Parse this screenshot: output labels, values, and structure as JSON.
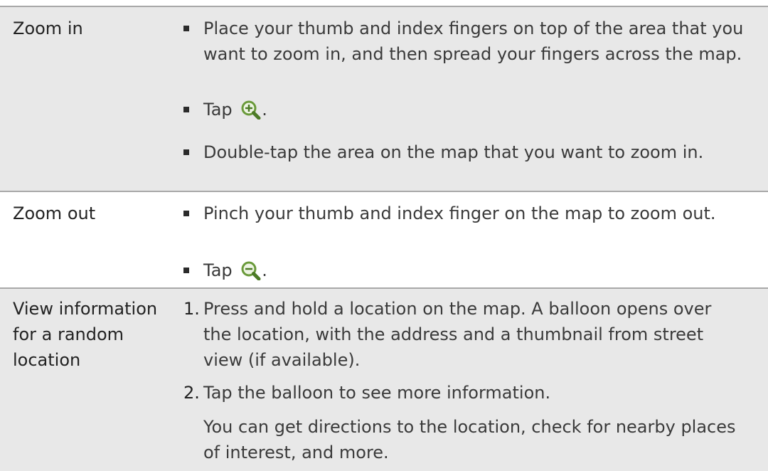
{
  "rows": [
    {
      "label": "Zoom in",
      "items": [
        {
          "text": "Place your thumb and index fingers on top of the area that you want to zoom in, and then spread your fingers across the map."
        },
        {
          "text": "Tap",
          "icon": "zoom-in-icon",
          "suffix": "."
        },
        {
          "text": "Double-tap the area on the map that you want to zoom in."
        }
      ]
    },
    {
      "label": "Zoom out",
      "items": [
        {
          "text": "Pinch your thumb and index finger on the map to zoom out."
        },
        {
          "text": "Tap",
          "icon": "zoom-out-icon",
          "suffix": "."
        }
      ]
    },
    {
      "label": "View information for a random location",
      "items": [
        {
          "num": "1.",
          "text": "Press and hold a location on the map. A balloon opens over the location, with the address and a thumbnail from street view (if available)."
        },
        {
          "num": "2.",
          "text": "Tap the balloon to see more information."
        },
        {
          "text": "You can get directions to the location, check for nearby places of interest, and more."
        }
      ]
    }
  ],
  "colors": {
    "shaded_row": "#e8e8e8",
    "rule": "#a8a8a8",
    "icon_glass": "#6a9a3a"
  }
}
